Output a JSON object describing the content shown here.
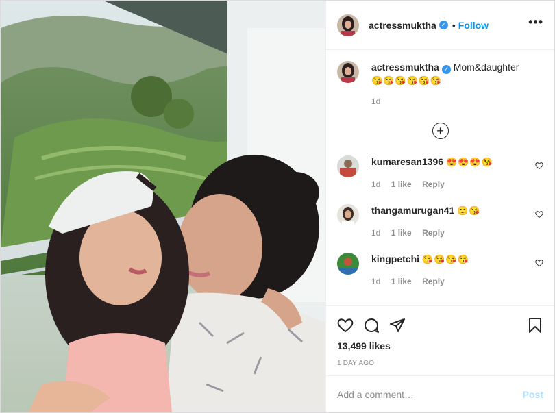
{
  "post": {
    "author": "actressmuktha",
    "follow_label": "Follow",
    "separator": "•",
    "more_icon": "more-horizontal-icon",
    "more_label": "•••"
  },
  "caption": {
    "username": "actressmuktha",
    "text": "Mom&daughter",
    "emojis": "😘😘😘😘😘😘",
    "time": "1d"
  },
  "load_more_icon": "plus-circle-icon",
  "load_more_label": "+",
  "comments": [
    {
      "username": "kumaresan1396",
      "emojis": "😍😍😍😘",
      "time": "1d",
      "likes": "1 like",
      "reply": "Reply"
    },
    {
      "username": "thangamurugan41",
      "emojis": "🙂😘",
      "time": "1d",
      "likes": "1 like",
      "reply": "Reply"
    },
    {
      "username": "kingpetchi",
      "emojis": "😘😘😘😘",
      "time": "1d",
      "likes": "1 like",
      "reply": "Reply"
    }
  ],
  "actions": {
    "like_icon": "heart-icon",
    "comment_icon": "comment-icon",
    "share_icon": "paper-plane-icon",
    "save_icon": "bookmark-icon"
  },
  "likes_text": "13,499 likes",
  "date_text": "1 DAY AGO",
  "add_comment": {
    "placeholder": "Add a comment…",
    "post_label": "Post"
  },
  "colors": {
    "link": "#0095f6",
    "verified": "#3897f0",
    "post_disabled": "#b2dffc",
    "muted": "#8e8e8e"
  }
}
